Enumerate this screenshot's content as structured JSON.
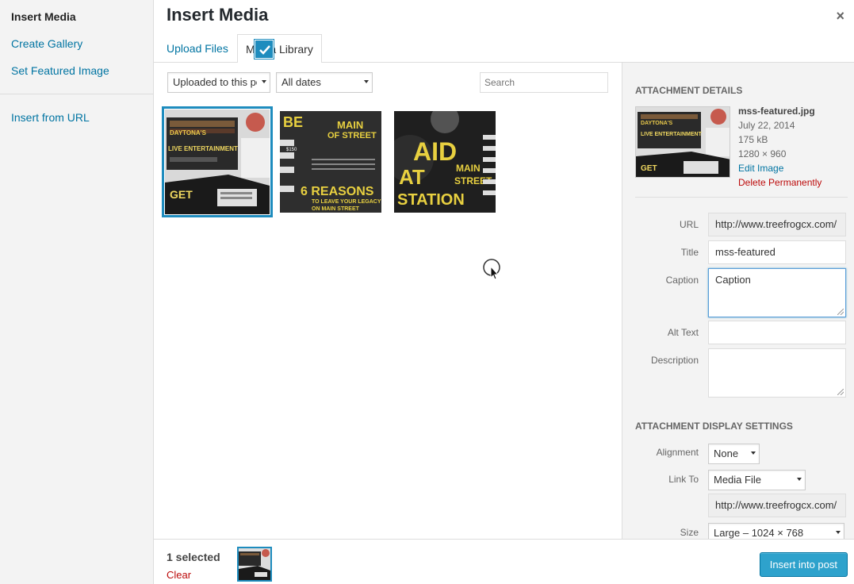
{
  "menu": {
    "items": [
      "Insert Media",
      "Create Gallery",
      "Set Featured Image"
    ],
    "url_item": "Insert from URL"
  },
  "title": "Insert Media",
  "close_glyph": "×",
  "tabs": {
    "upload": "Upload Files",
    "library": "Media Library"
  },
  "filters": {
    "type": "Uploaded to this po",
    "date": "All dates",
    "search_placeholder": "Search"
  },
  "thumbnails": [
    {
      "name": "mss-featured",
      "selected": true,
      "text": [
        "DAYTONA'S",
        "LIVE ENTERTAINMENT",
        "GET"
      ]
    },
    {
      "name": "main-street-reasons",
      "selected": false,
      "text": [
        "BE",
        "MAIN",
        "OF STREET",
        "$150",
        "6 REASONS",
        "TO LEAVE YOUR LEGACY",
        "ON MAIN STREET"
      ]
    },
    {
      "name": "raid-main-street",
      "selected": false,
      "text": [
        "AID",
        "AT",
        "STATION",
        "MAIN",
        "STREET"
      ]
    }
  ],
  "details": {
    "heading": "Attachment Details",
    "filename": "mss-featured.jpg",
    "date": "July 22, 2014",
    "size": "175 kB",
    "dimensions": "1280 × 960",
    "edit": "Edit Image",
    "delete": "Delete Permanently",
    "thumb_text": [
      "DAYTONA'S",
      "LIVE ENTERTAINMENT",
      "GET"
    ]
  },
  "fields": {
    "url": {
      "label": "URL",
      "value": "http://www.treefrogcx.com/"
    },
    "title": {
      "label": "Title",
      "value": "mss-featured"
    },
    "caption": {
      "label": "Caption",
      "value": "Caption"
    },
    "alt": {
      "label": "Alt Text",
      "value": ""
    },
    "description": {
      "label": "Description",
      "value": ""
    }
  },
  "display": {
    "heading": "Attachment Display Settings",
    "alignment": {
      "label": "Alignment",
      "value": "None"
    },
    "link_to": {
      "label": "Link To",
      "value": "Media File"
    },
    "link_url": "http://www.treefrogcx.com/",
    "size": {
      "label": "Size",
      "value": "Large – 1024 × 768"
    }
  },
  "toolbar": {
    "selected": "1 selected",
    "clear": "Clear",
    "insert": "Insert into post"
  },
  "colors": {
    "accent": "#1e8cbe",
    "link": "#0074a2",
    "danger": "#bc0b0b",
    "button": "#2ea2cc"
  }
}
